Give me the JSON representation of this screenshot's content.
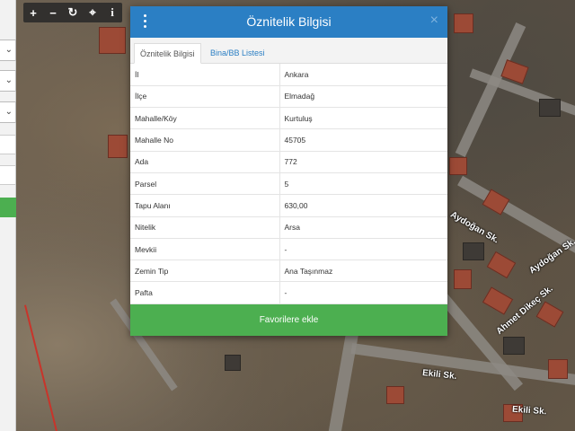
{
  "toolbar": {
    "zoom_in": "+",
    "zoom_out": "−",
    "refresh": "↻",
    "locate": "⌖",
    "info": "i"
  },
  "map": {
    "street_labels": [
      "Aydoğan Sk.",
      "Ahmet Dikeç Sk.",
      "Ekili Sk.",
      "Ekili Sk.",
      "Aydoğan Sk."
    ]
  },
  "modal": {
    "title": "Öznitelik Bilgisi",
    "close": "×",
    "tabs": [
      {
        "label": "Öznitelik Bilgisi",
        "active": true
      },
      {
        "label": "Bina/BB Listesi",
        "active": false
      }
    ],
    "rows": [
      {
        "key": "İl",
        "value": "Ankara"
      },
      {
        "key": "İlçe",
        "value": "Elmadağ"
      },
      {
        "key": "Mahalle/Köy",
        "value": "Kurtuluş"
      },
      {
        "key": "Mahalle No",
        "value": "45705"
      },
      {
        "key": "Ada",
        "value": "772"
      },
      {
        "key": "Parsel",
        "value": "5"
      },
      {
        "key": "Tapu Alanı",
        "value": "630,00"
      },
      {
        "key": "Nitelik",
        "value": "Arsa"
      },
      {
        "key": "Mevkii",
        "value": "-"
      },
      {
        "key": "Zemin Tip",
        "value": "Ana Taşınmaz"
      },
      {
        "key": "Pafta",
        "value": "-"
      }
    ],
    "favorite_button": "Favorilere ekle"
  },
  "colors": {
    "header_blue": "#2b7fc4",
    "favorite_green": "#4caf50"
  }
}
